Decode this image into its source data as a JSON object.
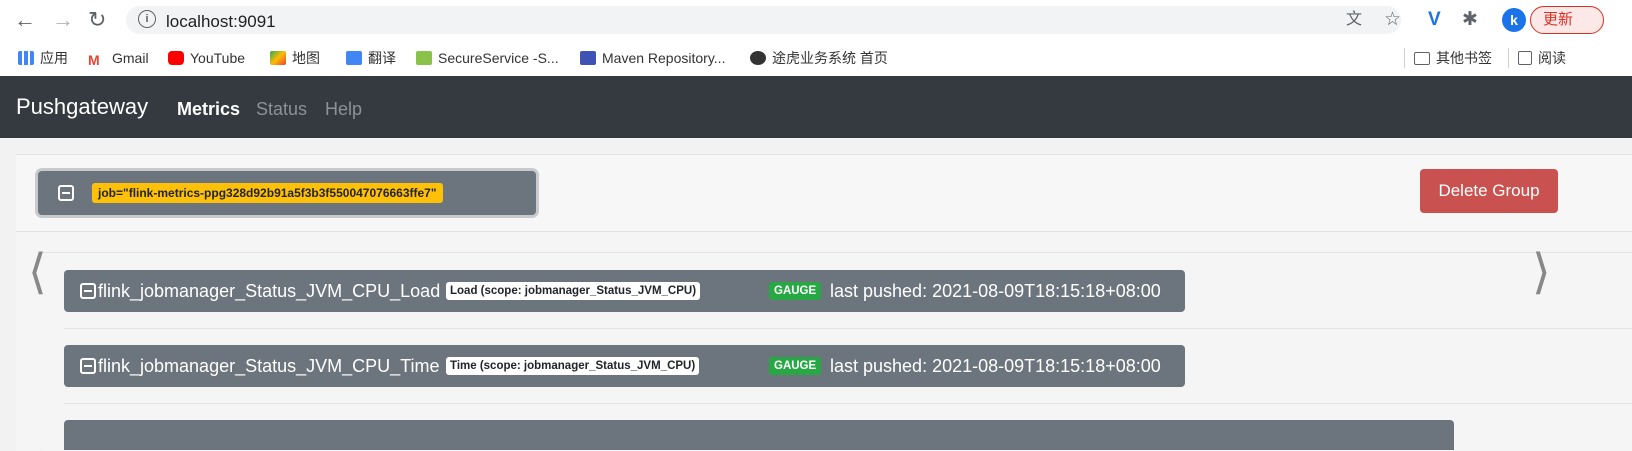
{
  "browser": {
    "url": "localhost:9091",
    "back_icon": "arrow-left-icon",
    "forward_icon": "arrow-right-icon",
    "reload_icon": "reload-icon",
    "profile_initial": "k",
    "update_label": "更新",
    "bookmarks": [
      {
        "label": "应用",
        "icon": "apps-grid-icon",
        "color": "#4285f4"
      },
      {
        "label": "Gmail",
        "icon": "gmail-icon",
        "color": "#ea4335"
      },
      {
        "label": "YouTube",
        "icon": "youtube-icon",
        "color": "#ff0000"
      },
      {
        "label": "地图",
        "icon": "maps-icon",
        "color": "#34a853"
      },
      {
        "label": "翻译",
        "icon": "translate-icon",
        "color": "#4285f4"
      },
      {
        "label": "SecureService -S...",
        "icon": "secure-service-icon",
        "color": "#8bc34a"
      },
      {
        "label": "Maven Repository...",
        "icon": "maven-icon",
        "color": "#3f51b5"
      },
      {
        "label": "途虎业务系统 首页",
        "icon": "globe-icon",
        "color": "#333333"
      }
    ],
    "other_bookmarks": "其他书签",
    "reading_list": "阅读"
  },
  "app": {
    "brand": "Pushgateway",
    "nav": [
      {
        "label": "Metrics",
        "active": true
      },
      {
        "label": "Status",
        "active": false
      },
      {
        "label": "Help",
        "active": false
      }
    ]
  },
  "group": {
    "job_label": "job=\"flink-metrics-ppg328d92b91a5f3b3f550047076663ffe7\"",
    "delete_label": "Delete Group",
    "metrics": [
      {
        "name": "flink_jobmanager_Status_JVM_CPU_Load",
        "help": "Load (scope: jobmanager_Status_JVM_CPU)",
        "type": "GAUGE",
        "last_pushed": "last pushed: 2021-08-09T18:15:18+08:00"
      },
      {
        "name": "flink_jobmanager_Status_JVM_CPU_Time",
        "help": "Time (scope: jobmanager_Status_JVM_CPU)",
        "type": "GAUGE",
        "last_pushed": "last pushed: 2021-08-09T18:15:18+08:00"
      }
    ]
  },
  "colors": {
    "navbar": "#343a40",
    "job_label": "#ffc107",
    "delete": "#c9514f",
    "gauge": "#28a745",
    "metric_button": "#6c757d"
  }
}
